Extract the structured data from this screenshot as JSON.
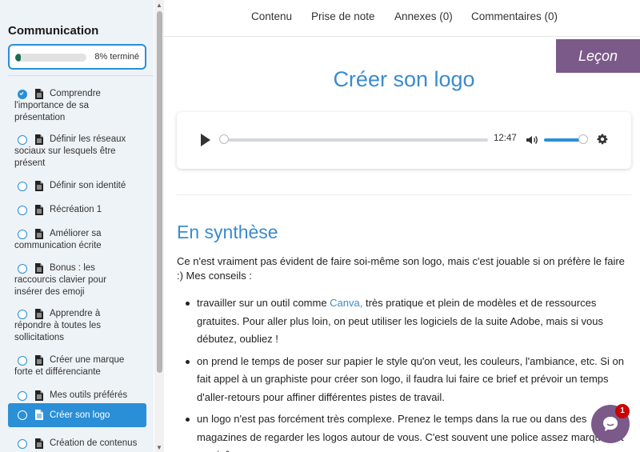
{
  "sidebar": {
    "title": "Communication",
    "progress": {
      "percent": 8,
      "label": "8% terminé"
    },
    "lessons": [
      {
        "lines": [
          "Comprendre",
          "l'importance de sa",
          "présentation"
        ],
        "done": true
      },
      {
        "lines": [
          "Définir les réseaux",
          "sociaux sur lesquels être",
          "présent"
        ],
        "done": false
      },
      {
        "lines": [
          "Définir son identité"
        ],
        "done": false
      },
      {
        "lines": [
          "Récréation 1"
        ],
        "done": false
      },
      {
        "lines": [
          "Améliorer sa",
          "communication écrite"
        ],
        "done": false
      },
      {
        "lines": [
          "Bonus : les",
          "raccourcis clavier pour",
          "insérer des emoji"
        ],
        "done": false
      },
      {
        "lines": [
          "Apprendre à",
          "répondre à toutes les",
          "sollicitations"
        ],
        "done": false
      },
      {
        "lines": [
          "Créer une marque",
          "forte et différenciante"
        ],
        "done": false
      },
      {
        "lines": [
          "Mes outils préférés"
        ],
        "done": false
      },
      {
        "lines": [
          "Créer son logo"
        ],
        "done": false,
        "active": true
      },
      {
        "lines": [
          "Création de contenus"
        ],
        "done": false
      }
    ]
  },
  "topnav": {
    "items": [
      "Contenu",
      "Prise de note",
      "Annexes (0)",
      "Commentaires (0)"
    ]
  },
  "badge": "Leçon",
  "page_title": "Créer son logo",
  "player": {
    "time": "12:47",
    "progress": 0,
    "volume": 0.9
  },
  "section_title": "En synthèse",
  "intro": "Ce n'est vraiment pas évident de faire soi-même son logo, mais c'est jouable si on préfère le faire :) Mes conseils :",
  "bullets": [
    {
      "before": "travailler sur un outil comme ",
      "link": "Canva,",
      "after": " très pratique et plein de modèles et de ressources gratuites. Pour aller plus loin, on peut utiliser les logiciels de la suite Adobe, mais si vous débutez, oubliez !"
    },
    {
      "before": "on prend le temps de poser sur papier le style qu'on veut, les couleurs, l'ambiance, etc. Si on fait appel à un graphiste pour créer son logo, il faudra lui faire ce brief et prévoir un temps d'aller-retours pour affiner différentes pistes de travail.",
      "link": "",
      "after": ""
    },
    {
      "before": "un logo n'est pas forcément très complexe. Prenez le temps dans la rue ou dans des magazines de regarder les logos autour de vous. C'est souvent une police assez marquée et une icône.",
      "link": "",
      "after": ""
    }
  ],
  "chat": {
    "badge": "1"
  },
  "colors": {
    "accent": "#2a8fd6",
    "title": "#3a8bcf",
    "badge": "#7b5a8a",
    "progress": "#1d6b55"
  }
}
